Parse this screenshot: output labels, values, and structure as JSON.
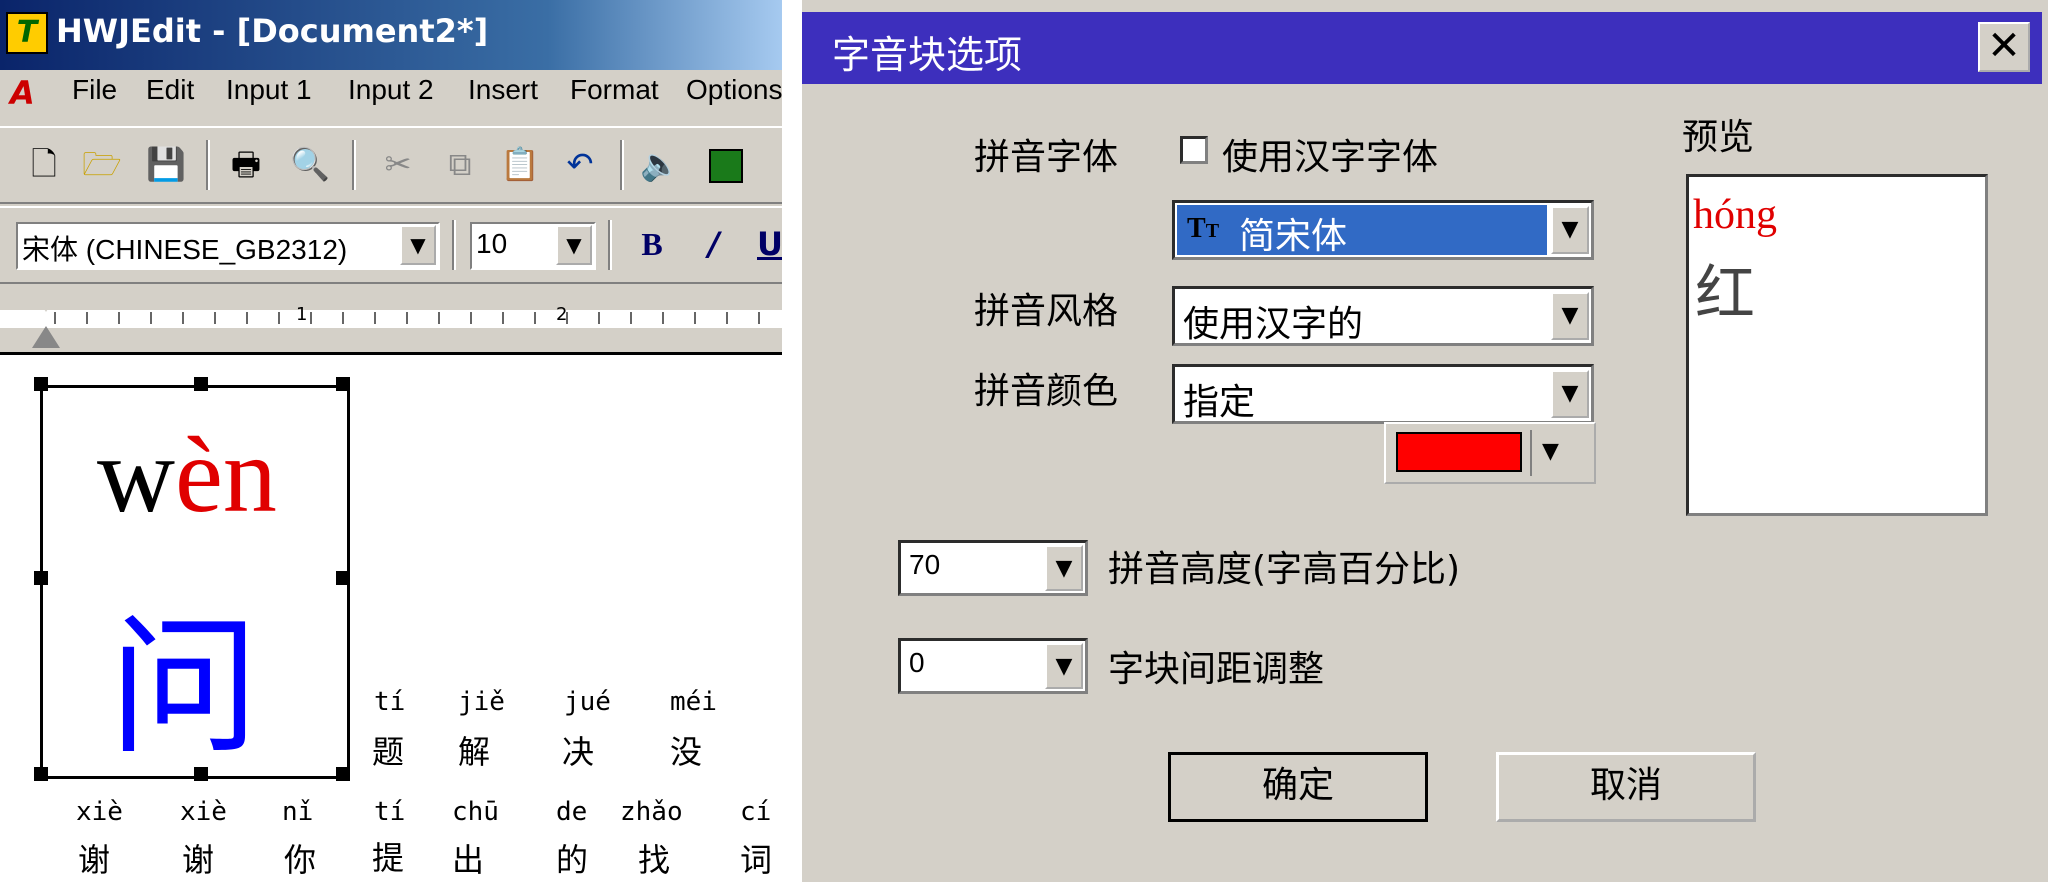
{
  "editor": {
    "title": "HWJEdit - [Document2*]",
    "menu": [
      "File",
      "Edit",
      "Input 1",
      "Input 2",
      "Insert",
      "Format",
      "Options"
    ],
    "font_name": "宋体 (CHINESE_GB2312)",
    "font_size": "10",
    "ruler_marks": [
      "1",
      "2"
    ],
    "big_block": {
      "pinyin_prefix": "w",
      "pinyin_tone": "èn",
      "hanzi": "问"
    },
    "row1": [
      {
        "py": "tí",
        "hz": "题"
      },
      {
        "py": "jiě",
        "hz": "解"
      },
      {
        "py": "jué",
        "hz": "决"
      },
      {
        "py": "méi",
        "hz": "没"
      }
    ],
    "row2": [
      {
        "py": "xiè",
        "hz": "谢"
      },
      {
        "py": "xiè",
        "hz": "谢"
      },
      {
        "py": "nǐ",
        "hz": "你"
      },
      {
        "py": "tí",
        "hz": "提"
      },
      {
        "py": "chū",
        "hz": "出"
      },
      {
        "py": "de",
        "hz": "的"
      },
      {
        "py": "zhǎo",
        "hz": "找"
      },
      {
        "py": "cí",
        "hz": "词"
      }
    ]
  },
  "dialog": {
    "title": "字音块选项",
    "pinyin_font_label": "拼音字体",
    "use_hanzi_font_label": "使用汉字字体",
    "font_value": "简宋体",
    "style_label": "拼音风格",
    "style_value": "使用汉字的",
    "color_label": "拼音颜色",
    "color_value": "指定",
    "color_swatch": "#ff0000",
    "preview_label": "预览",
    "preview_pinyin": "hóng",
    "preview_hanzi": "红",
    "height_value": "70",
    "height_label": "拼音高度(字高百分比)",
    "spacing_value": "0",
    "spacing_label": "字块间距调整",
    "ok_label": "确定",
    "cancel_label": "取消"
  }
}
